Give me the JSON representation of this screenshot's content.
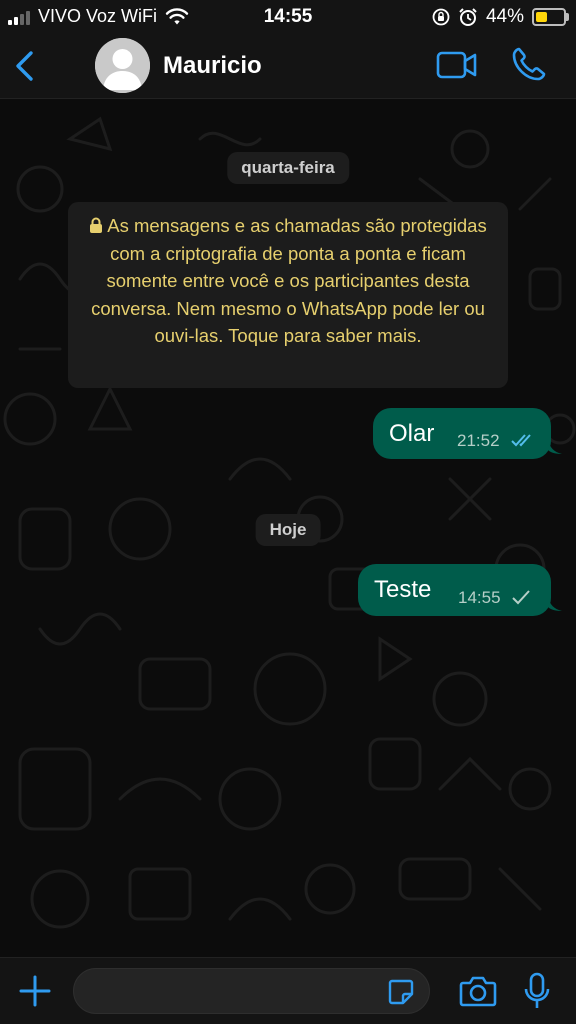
{
  "status_bar": {
    "carrier": "VIVO Voz WiFi",
    "time": "14:55",
    "battery": "44%",
    "battery_level": 0.44,
    "icons": [
      "signal-icon",
      "wifi-icon",
      "rotation-lock-icon",
      "alarm-icon",
      "battery-icon"
    ]
  },
  "header": {
    "contact_name": "Mauricio",
    "back_icon": "chevron-left-icon",
    "video_icon": "video-camera-icon",
    "call_icon": "phone-icon"
  },
  "chat": {
    "dates": {
      "first": "quarta-feira",
      "second": "Hoje"
    },
    "encryption_notice": "As mensagens e as chamadas são protegidas com a criptografia de ponta a ponta e ficam somente entre você e os participantes desta conversa. Nem mesmo o WhatsApp pode ler ou ouvi-las. Toque para saber mais.",
    "messages": [
      {
        "text": "Olar",
        "time": "21:52",
        "status": "read"
      },
      {
        "text": "Teste",
        "time": "14:55",
        "status": "sent"
      }
    ]
  },
  "composer": {
    "placeholder": "",
    "icons": [
      "plus-icon",
      "sticker-icon",
      "camera-icon",
      "microphone-icon"
    ]
  },
  "colors": {
    "accent_blue": "#2f9bf0",
    "bubble_outgoing": "#005c4b",
    "encryption_text": "#e6cf6e",
    "read_ticks": "#53bdeb",
    "background": "#0c0c0c"
  }
}
